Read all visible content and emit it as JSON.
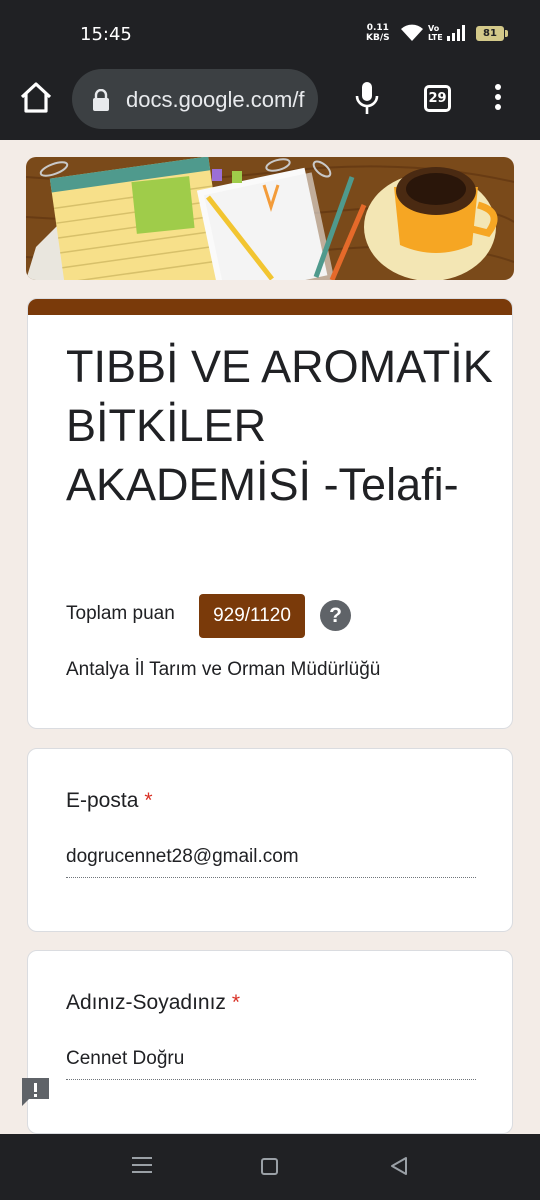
{
  "status": {
    "time": "15:45",
    "speed_value": "0.11",
    "speed_unit": "KB/S",
    "volte_line1": "Vo",
    "volte_line2": "LTE",
    "battery": "81"
  },
  "browser": {
    "url": "docs.google.com/f",
    "tab_count": "29"
  },
  "form": {
    "title": "TIBBİ VE AROMATİK BİTKİLER AKADEMİSİ -Telafi-",
    "score_label": "Toplam puan",
    "score": "929/1120",
    "help_symbol": "?",
    "description": "Antalya İl Tarım ve Orman Müdürlüğü",
    "accent_color": "#7a3a0a"
  },
  "questions": [
    {
      "label": "E-posta",
      "required_mark": "*",
      "answer": "dogrucennet28@gmail.com"
    },
    {
      "label": "Adınız-Soyadınız",
      "required_mark": "*",
      "answer": "Cennet Doğru"
    }
  ]
}
